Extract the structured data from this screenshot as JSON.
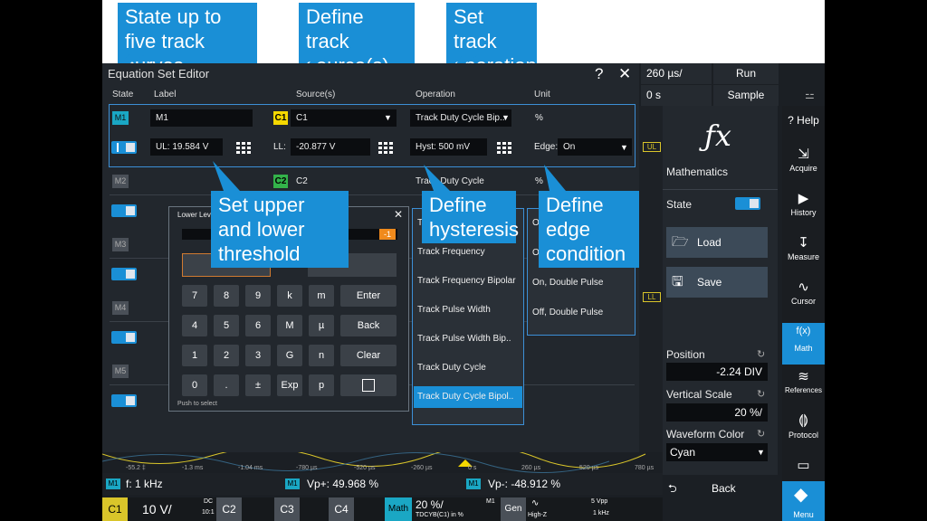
{
  "callouts": {
    "state": "State up to five track curves",
    "source": "Define track source(s)",
    "operation": "Set track operation",
    "threshold": "Set upper and lower threshold",
    "hysteresis": "Define hysteresis",
    "edge": "Define edge condition",
    "color": "#1a8fd6"
  },
  "editor": {
    "title": "Equation Set Editor",
    "help_btn": "?",
    "close_btn": "✕",
    "headers": {
      "state": "State",
      "label": "Label",
      "source": "Source(s)",
      "operation": "Operation",
      "unit": "Unit"
    },
    "rows": [
      {
        "badge": "M1",
        "label": "M1",
        "source_badge": "C1",
        "source": "C1",
        "operation": "Track Duty Cycle Bip..",
        "unit": "%",
        "ul": "UL: 19.584 V",
        "ll_label": "LL:",
        "ll": "-20.877 V",
        "hyst": "Hyst: 500 mV",
        "edge_label": "Edge:",
        "edge": "On"
      },
      {
        "badge": "M2",
        "source_badge": "C2",
        "source": "C2",
        "operation": "Track Duty Cycle",
        "unit": "%"
      },
      {
        "badge": "M3"
      },
      {
        "badge": "M4"
      },
      {
        "badge": "M5"
      }
    ],
    "colors": {
      "c1": "#f5d800",
      "c2": "#33b24a",
      "badge_active": "#1aa7c4",
      "badge_inactive": "#4a5058"
    }
  },
  "keypad": {
    "title": "Lower Leve",
    "close": "✕",
    "indicator": "-1",
    "keys": [
      "7",
      "8",
      "9",
      "k",
      "m",
      "Enter",
      "4",
      "5",
      "6",
      "M",
      "µ",
      "Back",
      "1",
      "2",
      "3",
      "G",
      "n",
      "Clear",
      "0",
      ".",
      "±",
      "Exp",
      "p"
    ],
    "hint": "Push to select"
  },
  "operation_list": {
    "partial": "T",
    "items": [
      "Track Frequency",
      "Track Frequency Bipolar",
      "Track Pulse Width",
      "Track Pulse Width Bip..",
      "Track Duty Cycle",
      "Track Duty Cycle Bipol.."
    ],
    "selected": "Track Duty Cycle Bipol.."
  },
  "edge_list": {
    "partial": "O",
    "items": [
      "Off",
      "On, Double Pulse",
      "Off, Double Pulse"
    ]
  },
  "status": {
    "timebase": "260 µs/",
    "run": "Run",
    "offset": "0 s",
    "mode": "Sample",
    "ul_marker": "UL",
    "ll_marker": "LL"
  },
  "math_panel": {
    "symbol": "ƒx",
    "title": "Mathematics",
    "state_label": "State",
    "load": "Load",
    "save": "Save",
    "position_label": "Position",
    "position_value": "-2.24 DIV",
    "vscale_label": "Vertical Scale",
    "vscale_value": "20 %/",
    "wcolor_label": "Waveform Color",
    "wcolor_value": "Cyan",
    "back": "Back"
  },
  "sidebar": {
    "items": [
      {
        "icon": "?",
        "label": "Help"
      },
      {
        "icon": "⇲",
        "label": "Acquire"
      },
      {
        "icon": "▶",
        "label": "History"
      },
      {
        "icon": "↧",
        "label": "Measure"
      },
      {
        "icon": "∿",
        "label": "Cursor"
      },
      {
        "icon": "f(x)",
        "label": "Math"
      },
      {
        "icon": "≋",
        "label": "References"
      },
      {
        "icon": "⟬⟭",
        "label": "Protocol"
      },
      {
        "icon": "▭",
        "label": ""
      },
      {
        "icon": "◆",
        "label": "Menu"
      }
    ]
  },
  "axis": {
    "ticks": [
      "-55.2 ‡",
      "-1.3 ms",
      "-1.04 ms",
      "-780 µs",
      "-520 µs",
      "-260 µs",
      "0 s",
      "260 µs",
      "520 µs",
      "780 µs"
    ]
  },
  "measure": {
    "m1_a": "M1",
    "freq": "f: 1 kHz",
    "m1_b": "M1",
    "vp_plus": "Vp+: 49.968 %",
    "m1_c": "M1",
    "vp_minus": "Vp-: -48.912 %"
  },
  "channels": {
    "c1": "C1",
    "c1_scale": "10 V/",
    "c1_dc": "DC",
    "c1_ratio": "10:1",
    "c2": "C2",
    "c3": "C3",
    "c4": "C4",
    "math": "Math",
    "math_scale": "20 %/",
    "math_m1": "M1",
    "math_src": "TDCYB(C1) in %",
    "gen": "Gen",
    "gen_mode": "High-Z",
    "gen_amp": "5 Vpp",
    "gen_freq": "1 kHz"
  }
}
